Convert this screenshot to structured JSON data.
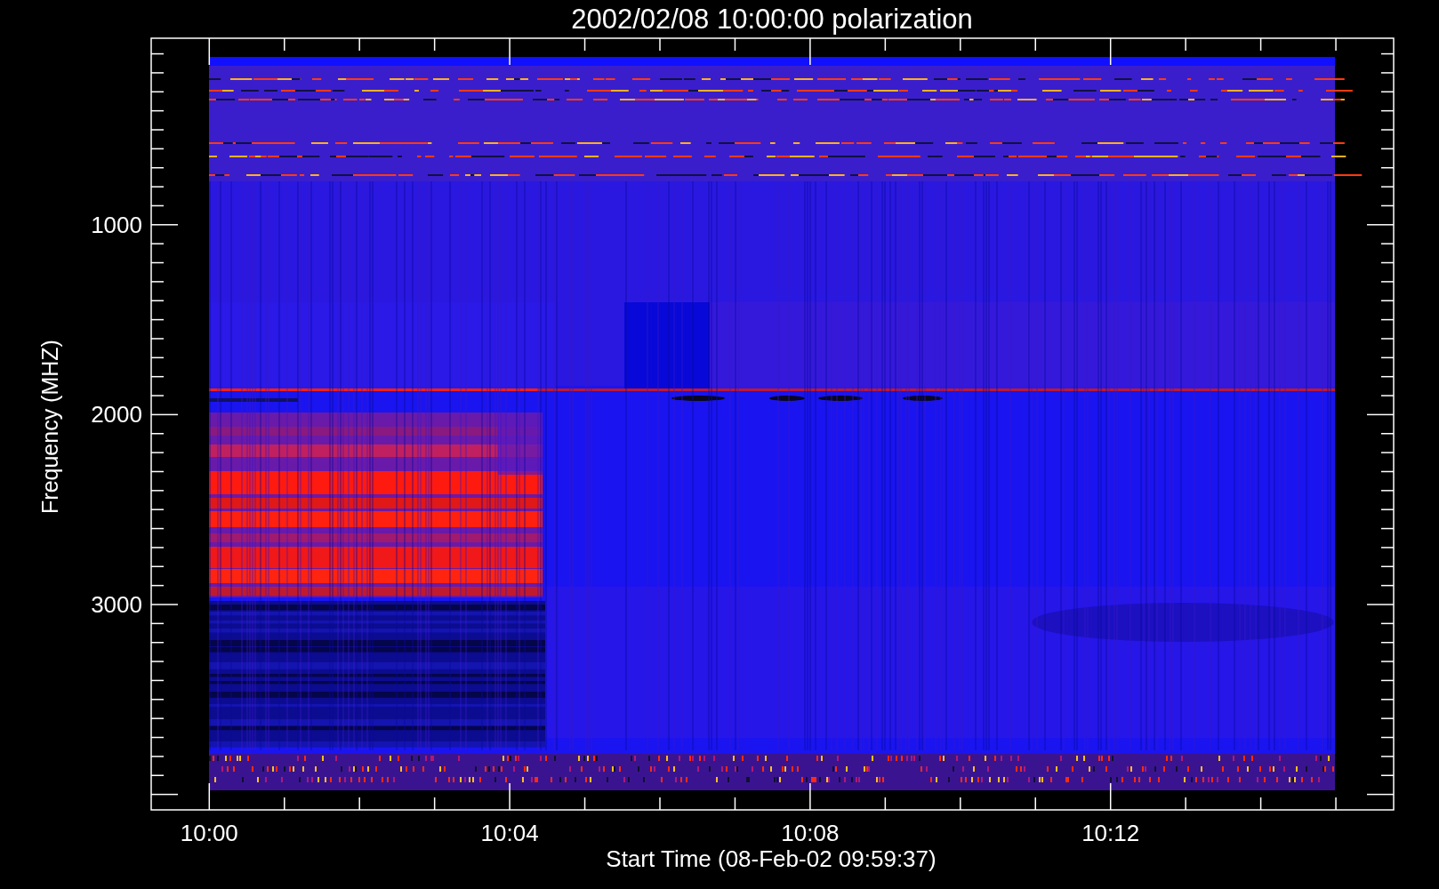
{
  "title": "2002/02/08 10:00:00 polarization",
  "y_axis": {
    "label": "Frequency (MHZ)",
    "ticks": [
      "1000",
      "2000",
      "3000"
    ]
  },
  "x_axis": {
    "label": "Start Time (08-Feb-02 09:59:37)",
    "ticks": [
      "10:00",
      "10:04",
      "10:08",
      "10:12"
    ]
  }
}
